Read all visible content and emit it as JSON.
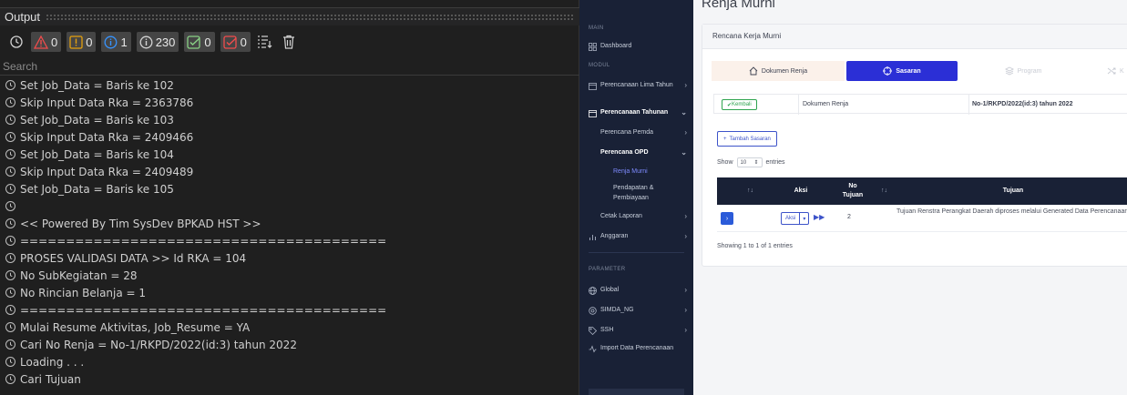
{
  "output_panel": {
    "title": "Output",
    "toolbar": {
      "errors": "0",
      "warnings": "0",
      "info": "1",
      "logs": "230",
      "success": "0",
      "checks": "0"
    },
    "search_placeholder": "Search",
    "log_lines": [
      "Set Job_Data = Baris ke 102",
      "Skip Input Data Rka = 2363786",
      "Set Job_Data = Baris ke 103",
      "Skip Input Data Rka = 2409466",
      "Set Job_Data = Baris ke 104",
      "Skip Input Data Rka = 2409489",
      "Set Job_Data = Baris ke 105",
      "",
      "<< Powered By Tim SysDev BPKAD HST >>",
      "========================================",
      "PROSES VALIDASI DATA >> Id RKA = 104",
      "No SubKegiatan = 28",
      "No Rincian Belanja = 1",
      "========================================",
      "Mulai Resume Aktivitas, Job_Resume = YA",
      "Cari No Renja = No-1/RKPD/2022(id:3) tahun 2022",
      "Loading . . .",
      "Cari Tujuan"
    ]
  },
  "sidebar": {
    "section_main": "MAIN",
    "dashboard": "Dashboard",
    "section_modul": "MODUL",
    "perencanaan_lima_tahun": "Perencanaan Lima Tahun",
    "perencanaan_tahunan": "Perencanaan Tahunan",
    "perencana_pemda": "Perencana Pemda",
    "perencana_opd": "Perencana OPD",
    "renja_murni": "Renja Murni",
    "pendapatan_pembiayaan": "Pendapatan & Pembiayaan",
    "cetak_laporan": "Cetak Laporan",
    "anggaran": "Anggaran",
    "section_parameter": "PARAMETER",
    "global": "Global",
    "simda_ng": "SIMDA_NG",
    "ssh": "SSH",
    "import_data": "Import Data Perencanaan"
  },
  "main": {
    "page_title": "Renja Murni",
    "card_title": "Rencana Kerja Murni",
    "tabs": {
      "dokumen_renja": "Dokumen Renja",
      "sasaran": "Sasaran",
      "program": "Program",
      "next": "K"
    },
    "kembali_button": "Kembali",
    "info_label": "Dokumen Renja",
    "info_value": "No-1/RKPD/2022(id:3) tahun 2022",
    "tambah_button": "Tambah Sasaran",
    "entries": {
      "show": "Show",
      "value": "10",
      "suffix": "entries"
    },
    "table": {
      "headers": {
        "aksi": "Aksi",
        "no_tujuan": "No Tujuan",
        "tujuan": "Tujuan"
      },
      "rows": [
        {
          "aksi": "Aksi",
          "no": "2",
          "tujuan": "Tujuan Renstra Perangkat Daerah diproses melalui Generated Data Perencanaan"
        }
      ]
    },
    "showing": "Showing 1 to 1 of 1 entries"
  },
  "colors": {
    "accent": "#2b2fd6",
    "sidebar_bg": "#192136",
    "success": "#2fa44f",
    "active_link": "#7e8bff"
  }
}
